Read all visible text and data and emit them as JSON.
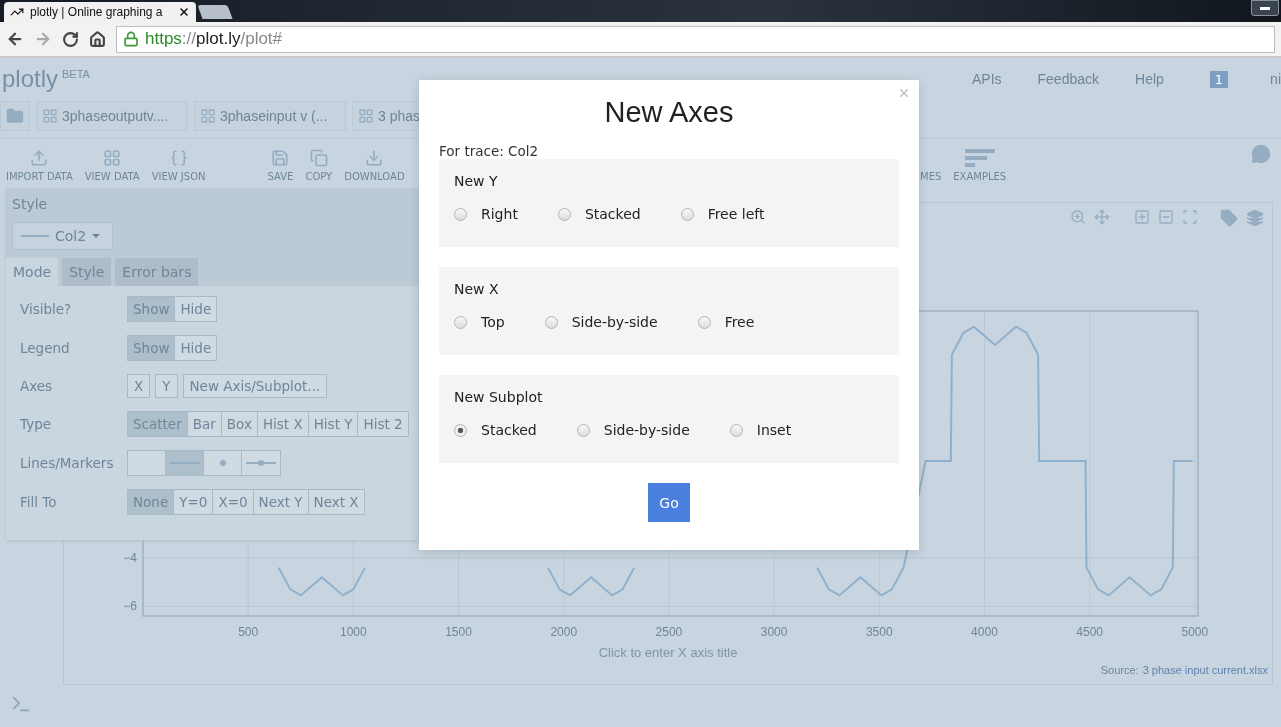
{
  "browser": {
    "tab_title": "plotly | Online graphing a",
    "url": {
      "scheme": "https",
      "separator": "://",
      "host": "plot.ly",
      "path": "/plot#"
    }
  },
  "header": {
    "logo": "plotly",
    "logo_badge": "BETA",
    "nav": [
      "APIs",
      "Feedback",
      "Help"
    ],
    "notification_count": "1",
    "user": "ni"
  },
  "file_tabs": [
    "3phaseoutputv....",
    "3phaseinput v (...",
    "3 phas"
  ],
  "toolbar": {
    "left": [
      {
        "kind": "upload",
        "label": "IMPORT DATA"
      },
      {
        "kind": "grid",
        "label": "VIEW DATA"
      },
      {
        "kind": "braces",
        "label": "VIEW JSON"
      }
    ],
    "middle": [
      {
        "kind": "save",
        "label": "SAVE"
      },
      {
        "kind": "copy",
        "label": "COPY"
      },
      {
        "kind": "download",
        "label": "DOWNLOAD"
      }
    ],
    "right": [
      {
        "kind": "hidden",
        "label": "MES"
      },
      {
        "kind": "bars",
        "label": "EXAMPLES"
      }
    ]
  },
  "style_panel": {
    "title": "Style",
    "trace": "Col2",
    "tabs": [
      {
        "label": "Mode",
        "selected": true
      },
      {
        "label": "Style",
        "selected": false
      },
      {
        "label": "Error bars",
        "selected": false
      }
    ],
    "rows": [
      {
        "label": "Visible?",
        "kind": "segmented",
        "options": [
          {
            "label": "Show",
            "selected": true
          },
          {
            "label": "Hide",
            "selected": false
          }
        ]
      },
      {
        "label": "Legend",
        "kind": "segmented",
        "options": [
          {
            "label": "Show",
            "selected": true
          },
          {
            "label": "Hide",
            "selected": false
          }
        ]
      },
      {
        "label": "Axes",
        "kind": "separate",
        "options": [
          {
            "label": "X",
            "selected": false
          },
          {
            "label": "Y",
            "selected": false
          },
          {
            "label": "New Axis/Subplot...",
            "selected": false
          }
        ]
      },
      {
        "label": "Type",
        "kind": "segmented",
        "options": [
          {
            "label": "Scatter",
            "selected": true
          },
          {
            "label": "Bar",
            "selected": false
          },
          {
            "label": "Box",
            "selected": false
          },
          {
            "label": "Hist X",
            "selected": false
          },
          {
            "label": "Hist Y",
            "selected": false
          },
          {
            "label": "Hist 2",
            "selected": false
          }
        ]
      },
      {
        "label": "Lines/Markers",
        "kind": "icons",
        "options": [
          {
            "kind": "blank",
            "selected": false
          },
          {
            "kind": "line",
            "selected": true
          },
          {
            "kind": "marker",
            "selected": false
          },
          {
            "kind": "line-marker",
            "selected": false
          }
        ]
      },
      {
        "label": "Fill To",
        "kind": "segmented",
        "options": [
          {
            "label": "None",
            "selected": true
          },
          {
            "label": "Y=0",
            "selected": false
          },
          {
            "label": "X=0",
            "selected": false
          },
          {
            "label": "Next Y",
            "selected": false
          },
          {
            "label": "Next X",
            "selected": false
          }
        ]
      }
    ]
  },
  "chart": {
    "chart_data": {
      "type": "line",
      "grid": true,
      "x": [
        645,
        700,
        750,
        850,
        950,
        1000,
        1055,
        1925,
        1980,
        2030,
        2130,
        2230,
        2280,
        2335,
        3205,
        3260,
        3310,
        3410,
        3510,
        3560,
        3615,
        3720,
        3840,
        3845,
        3900,
        3950,
        4050,
        4150,
        4200,
        4255,
        4260,
        4480,
        4485,
        4540,
        4590,
        4690,
        4790,
        4840,
        4895,
        4900,
        4990
      ],
      "series": [
        {
          "color": "#8fb0cc",
          "values": [
            -4.4,
            -5.3,
            -5.55,
            -4.8,
            -5.55,
            -5.3,
            -4.4,
            -4.4,
            -5.3,
            -5.55,
            -4.8,
            -5.55,
            -5.3,
            -4.4,
            -4.4,
            -5.3,
            -5.55,
            -4.8,
            -5.55,
            -5.3,
            -4.4,
            0,
            0,
            4.4,
            5.3,
            5.55,
            4.8,
            5.55,
            5.3,
            4.4,
            0,
            0,
            -4.4,
            -5.3,
            -5.55,
            -4.8,
            -5.55,
            -5.3,
            -4.4,
            0,
            0
          ]
        }
      ],
      "xlim": [
        0,
        5015
      ],
      "ylim": [
        -6.4,
        6.2
      ],
      "xticks": [
        500,
        1000,
        1500,
        2000,
        2500,
        3000,
        3500,
        4000,
        4500,
        5000
      ],
      "yticks": [
        {
          "value": -6,
          "label": "−6"
        },
        {
          "value": -4,
          "label": "−4"
        }
      ]
    },
    "x_title_placeholder": "Click to enter X axis title",
    "source_label": "Source:",
    "source_link": "3 phase input current.xlsx"
  },
  "modal": {
    "title": "New Axes",
    "subtitle": "For trace: Col2",
    "groups": [
      {
        "title": "New Y",
        "options": [
          {
            "label": "Right",
            "selected": false
          },
          {
            "label": "Stacked",
            "selected": false
          },
          {
            "label": "Free left",
            "selected": false
          }
        ]
      },
      {
        "title": "New X",
        "options": [
          {
            "label": "Top",
            "selected": false
          },
          {
            "label": "Side-by-side",
            "selected": false
          },
          {
            "label": "Free",
            "selected": false
          }
        ]
      },
      {
        "title": "New Subplot",
        "options": [
          {
            "label": "Stacked",
            "selected": true
          },
          {
            "label": "Side-by-side",
            "selected": false
          },
          {
            "label": "Inset",
            "selected": false
          }
        ]
      }
    ],
    "button": "Go"
  }
}
